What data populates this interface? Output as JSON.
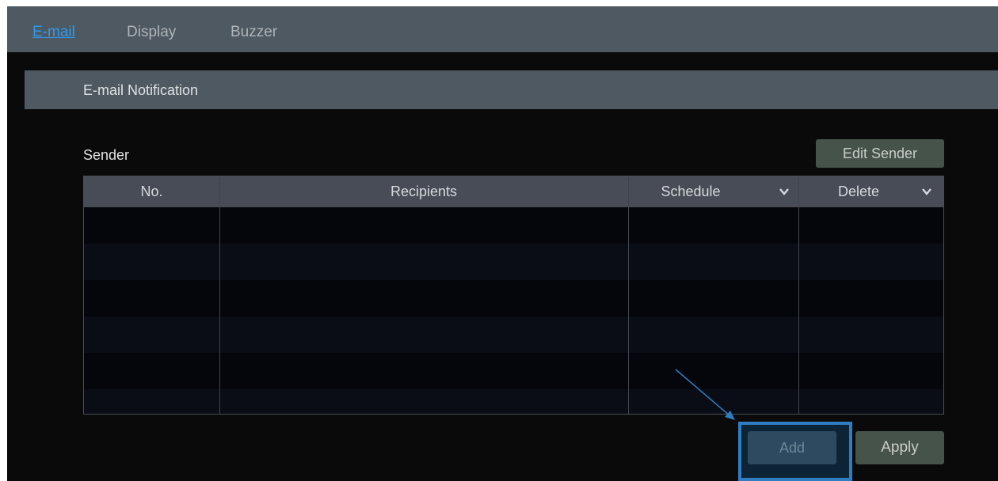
{
  "tabs": [
    {
      "label": "E-mail",
      "active": true
    },
    {
      "label": "Display",
      "active": false
    },
    {
      "label": "Buzzer",
      "active": false
    }
  ],
  "section": {
    "title": "E-mail Notification"
  },
  "sender": {
    "label": "Sender",
    "edit_button": "Edit Sender"
  },
  "table": {
    "columns": [
      {
        "label": "No.",
        "dropdown": false
      },
      {
        "label": "Recipients",
        "dropdown": false
      },
      {
        "label": "Schedule",
        "dropdown": true,
        "icon": "chevron-down-icon"
      },
      {
        "label": "Delete",
        "dropdown": true,
        "icon": "chevron-down-icon"
      }
    ],
    "rows": []
  },
  "actions": {
    "add_label": "Add",
    "apply_label": "Apply"
  },
  "colors": {
    "active_tab": "#2e9af0",
    "highlight_border": "#2f7ec2",
    "header_bar": "#4e5961",
    "background": "#0a0a0a"
  }
}
